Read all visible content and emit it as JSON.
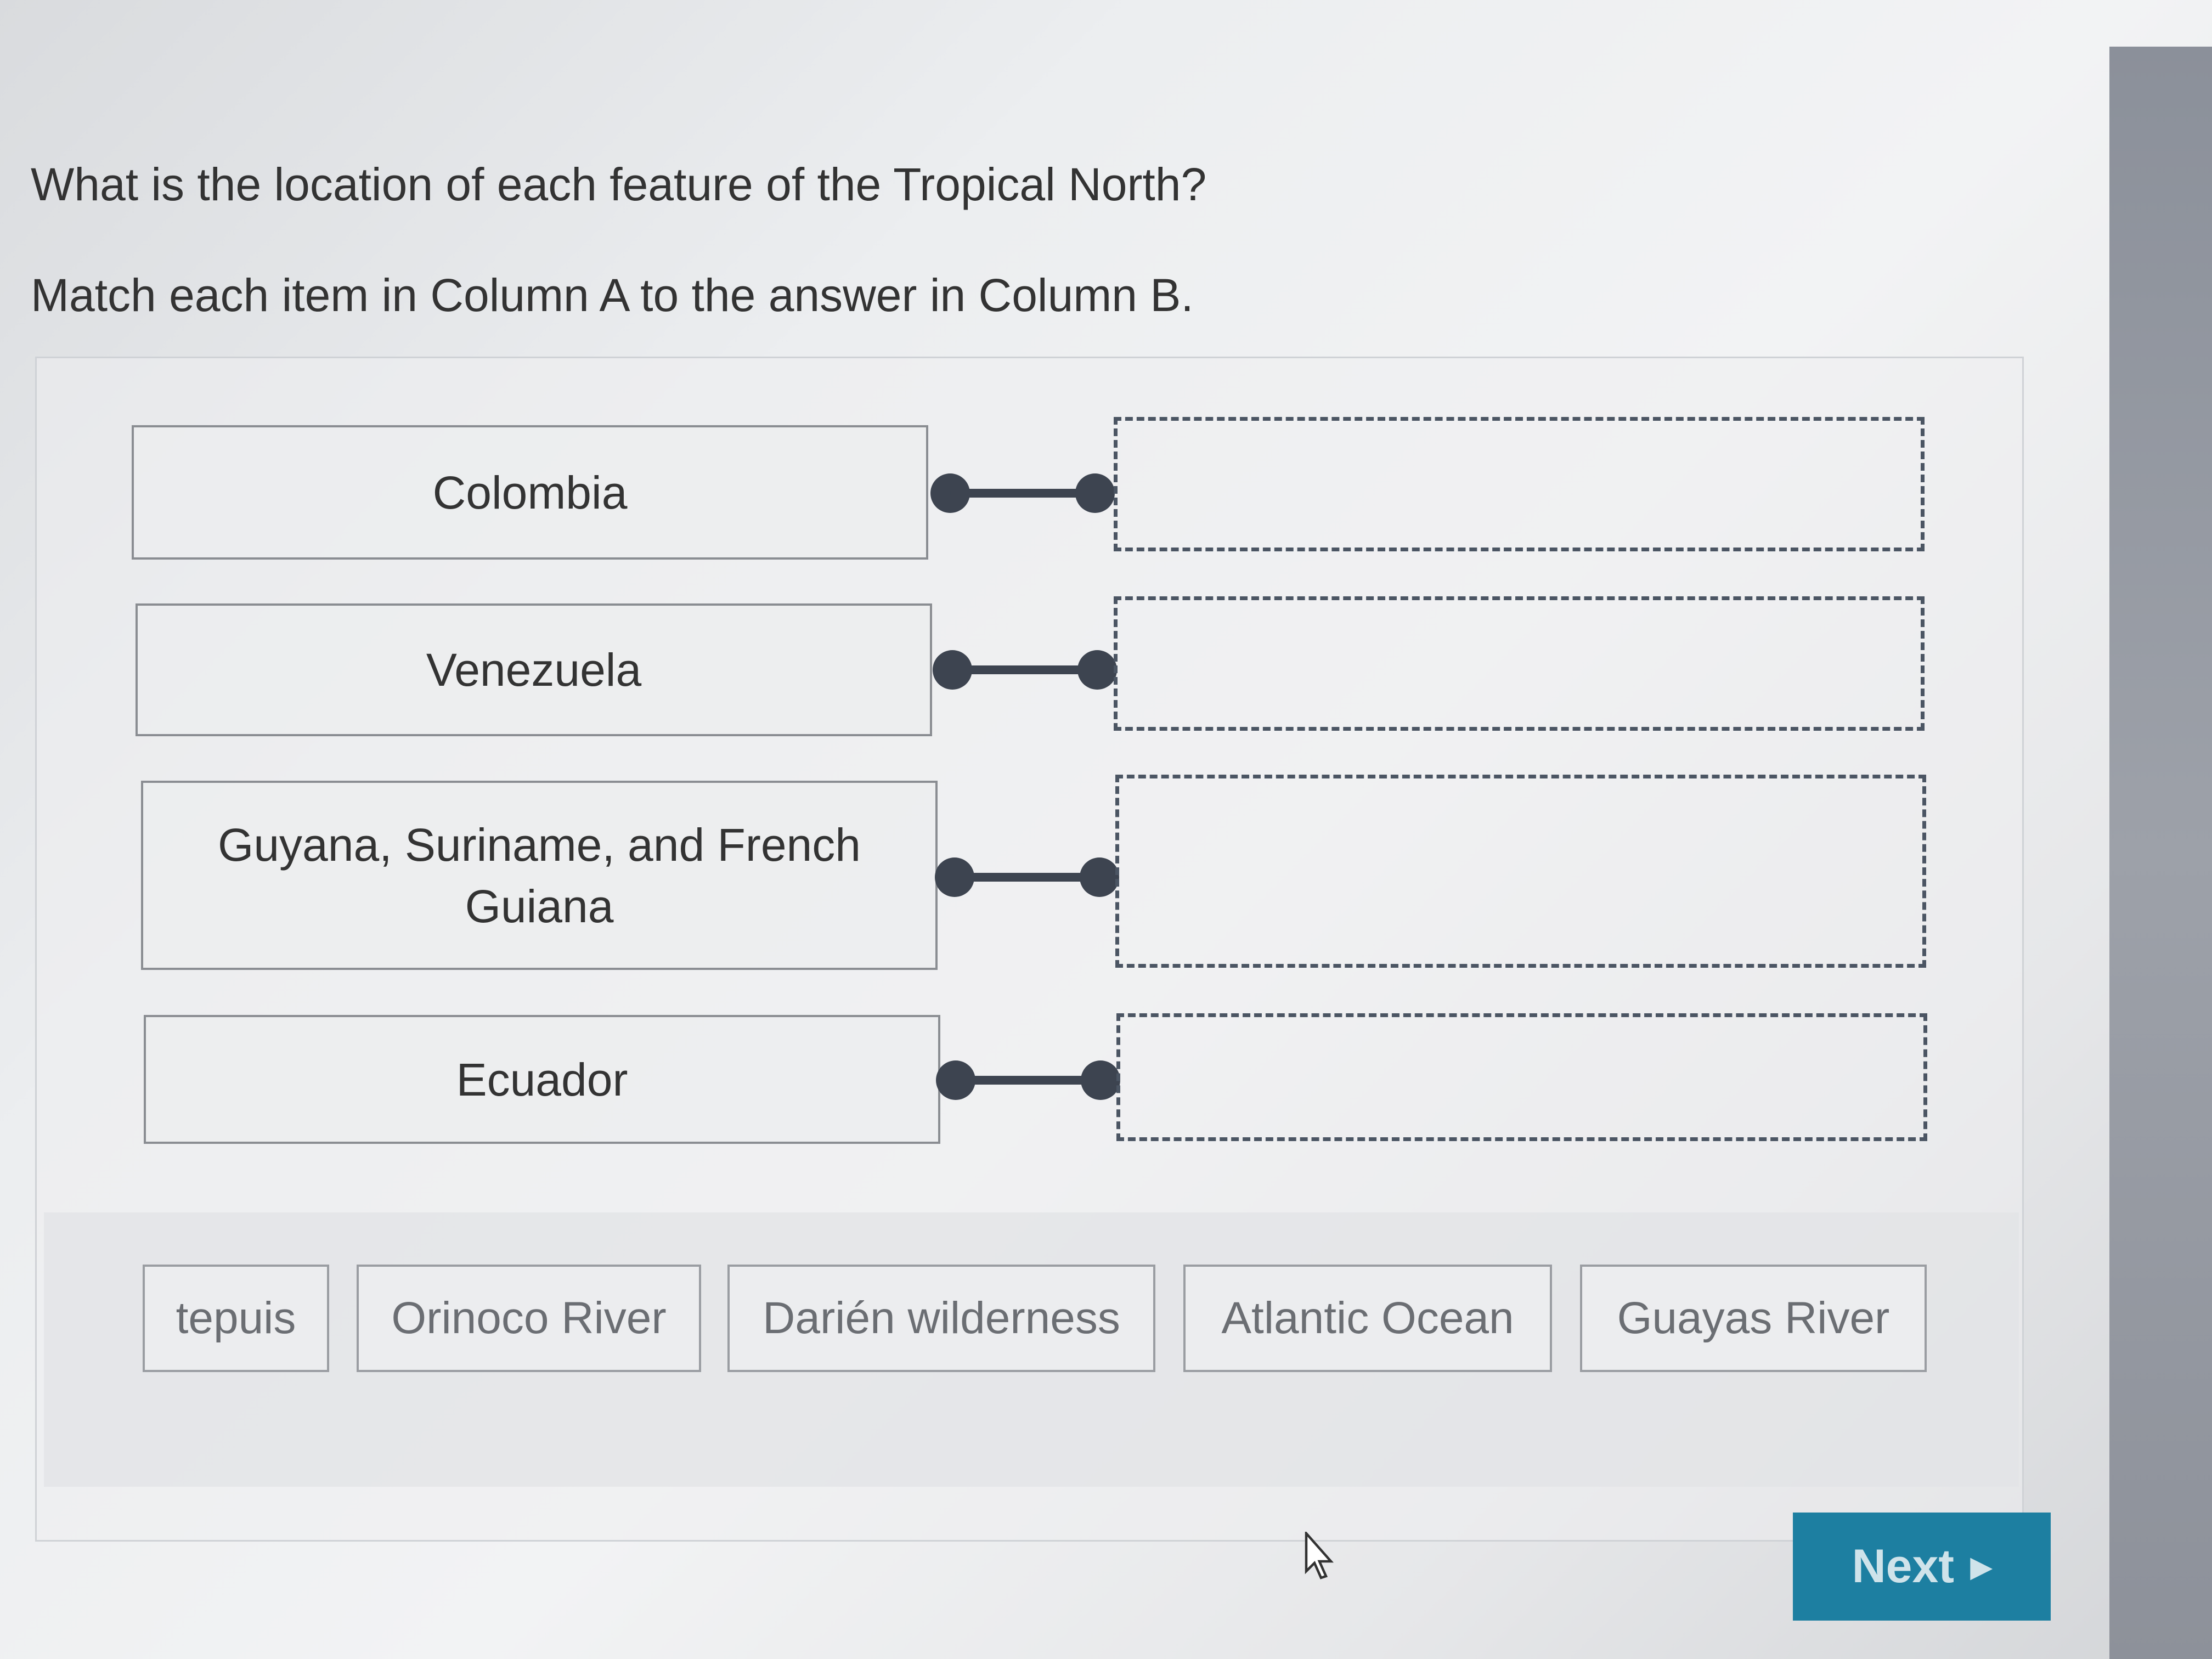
{
  "question": "What is the location of each feature of the Tropical North?",
  "instructions": "Match each item in Column A to the answer in Column B.",
  "column_a": [
    {
      "label": "Colombia"
    },
    {
      "label": "Venezuela"
    },
    {
      "label": "Guyana, Suriname, and French Guiana"
    },
    {
      "label": "Ecuador"
    }
  ],
  "answer_bank": [
    {
      "label": "tepuis"
    },
    {
      "label": "Orinoco River"
    },
    {
      "label": "Darién wilderness"
    },
    {
      "label": "Atlantic Ocean"
    },
    {
      "label": "Guayas River"
    }
  ],
  "next_button": {
    "label": "Next",
    "arrow_icon": "play-triangle-icon",
    "color": "#1d7fa1"
  },
  "icons": {
    "cursor": "mouse-pointer-icon",
    "connector": "connector-line-icon"
  }
}
